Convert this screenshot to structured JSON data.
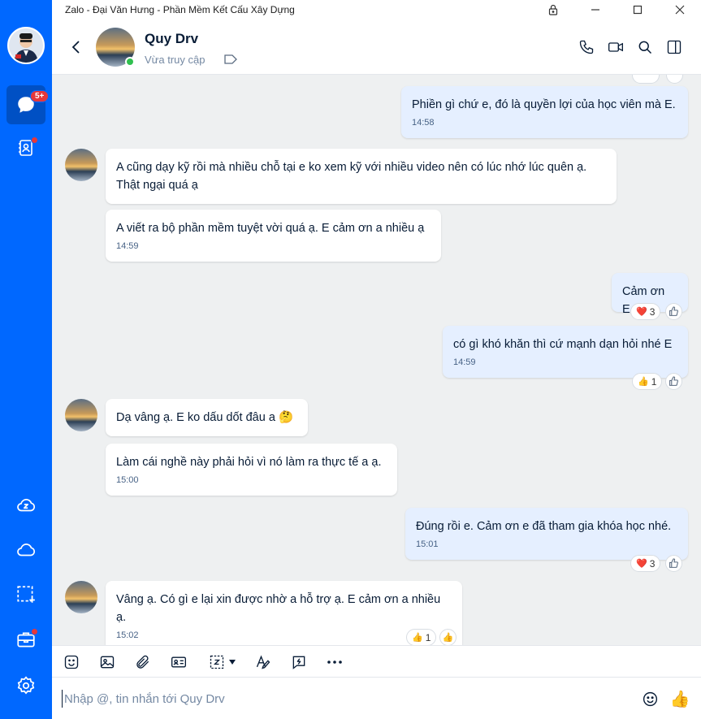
{
  "window": {
    "title": "Zalo - Đại Văn Hưng - Phần Mềm Kết Cấu Xây Dựng"
  },
  "sidebar": {
    "message_badge": "5+"
  },
  "header": {
    "name": "Quy Drv",
    "status": "Vừa truy cập"
  },
  "messages": [
    {
      "text": "Phiền gì chứ e, đó là quyền lợi của học viên mà E.",
      "time": "14:58"
    },
    {
      "text": "A cũng dạy kỹ rồi mà nhiều chỗ tại e ko xem kỹ với nhiều video nên có lúc nhớ lúc quên ạ. Thật ngại quá ạ"
    },
    {
      "text": "A viết ra bộ phần mềm tuyệt vời quá ạ. E cảm ơn a nhiều ạ",
      "time": "14:59"
    },
    {
      "text": "Cảm ơn E.",
      "reaction": "❤️",
      "reaction_count": "3"
    },
    {
      "text": "có gì khó khăn thì cứ mạnh dạn hỏi nhé E",
      "time": "14:59",
      "reaction": "👍",
      "reaction_count": "1"
    },
    {
      "text": "Dạ vâng ạ. E ko dấu dốt đâu a",
      "emoji": "🤔"
    },
    {
      "text": "Làm cái nghề này phải hỏi vì nó làm ra thực tế a ạ.",
      "time": "15:00"
    },
    {
      "text": "Đúng rồi e. Cảm ơn e đã tham gia khóa học nhé.",
      "time": "15:01",
      "reaction": "❤️",
      "reaction_count": "3"
    },
    {
      "text": "Vâng ạ. Có gì e lại xin được nhờ a hỗ trợ ạ. E cảm ơn a nhiều ạ.",
      "time": "15:02",
      "reaction": "👍",
      "reaction_count": "1"
    }
  ],
  "composer": {
    "placeholder": "Nhập @, tin nhắn tới Quy Drv",
    "send_emoji": "👍"
  },
  "colors": {
    "sidebar": "#0068ff",
    "outgoing_bubble": "#e5efff",
    "incoming_bubble": "#ffffff",
    "chat_bg": "#eef0f1"
  }
}
